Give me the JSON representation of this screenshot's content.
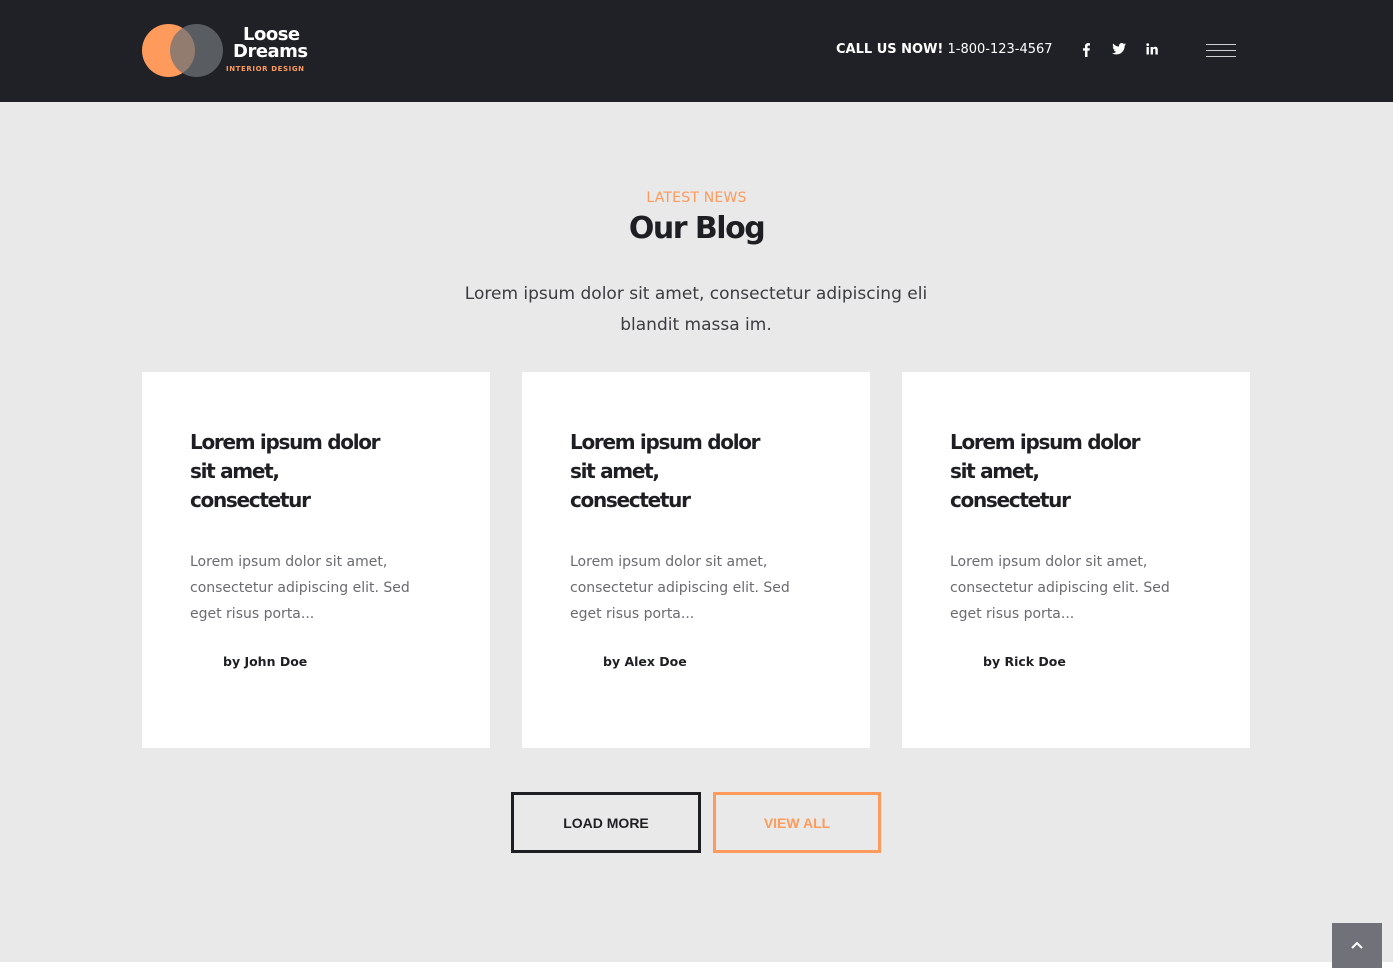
{
  "header": {
    "logo": {
      "line1": "Loose",
      "line2": "Dreams",
      "tagline": "INTERIOR DESIGN"
    },
    "call_label": "CALL US NOW!",
    "phone": "1-800-123-4567",
    "social": [
      {
        "icon": "facebook-icon",
        "glyph": "f"
      },
      {
        "icon": "twitter-icon",
        "glyph": "t"
      },
      {
        "icon": "linkedin-icon",
        "glyph": "in"
      }
    ],
    "menu_icon": "hamburger-menu-icon"
  },
  "section": {
    "kicker": "LATEST NEWS",
    "title": "Our Blog",
    "subtitle": "Lorem ipsum dolor sit amet, consectetur adipiscing eli blandit massa im."
  },
  "posts": [
    {
      "title": "Lorem ipsum dolor sit amet, consectetur",
      "excerpt": "Lorem ipsum dolor sit amet, consectetur adipiscing elit. Sed eget risus porta...",
      "author": "by John Doe"
    },
    {
      "title": "Lorem ipsum dolor sit amet, consectetur",
      "excerpt": "Lorem ipsum dolor sit amet, consectetur adipiscing elit. Sed eget risus porta...",
      "author": "by Alex Doe"
    },
    {
      "title": "Lorem ipsum dolor sit amet, consectetur",
      "excerpt": "Lorem ipsum dolor sit amet, consectetur adipiscing elit. Sed eget risus porta...",
      "author": "by Rick Doe"
    }
  ],
  "buttons": {
    "load_more": "LOAD MORE",
    "view_all": "VIEW ALL"
  },
  "colors": {
    "accent": "#fe9a5c",
    "header_bg": "#1f2126",
    "page_bg": "#e9e9e9",
    "text_dark": "#1e1f23"
  },
  "scroll_top": {
    "icon": "chevron-up-icon",
    "glyph": "⌃"
  }
}
